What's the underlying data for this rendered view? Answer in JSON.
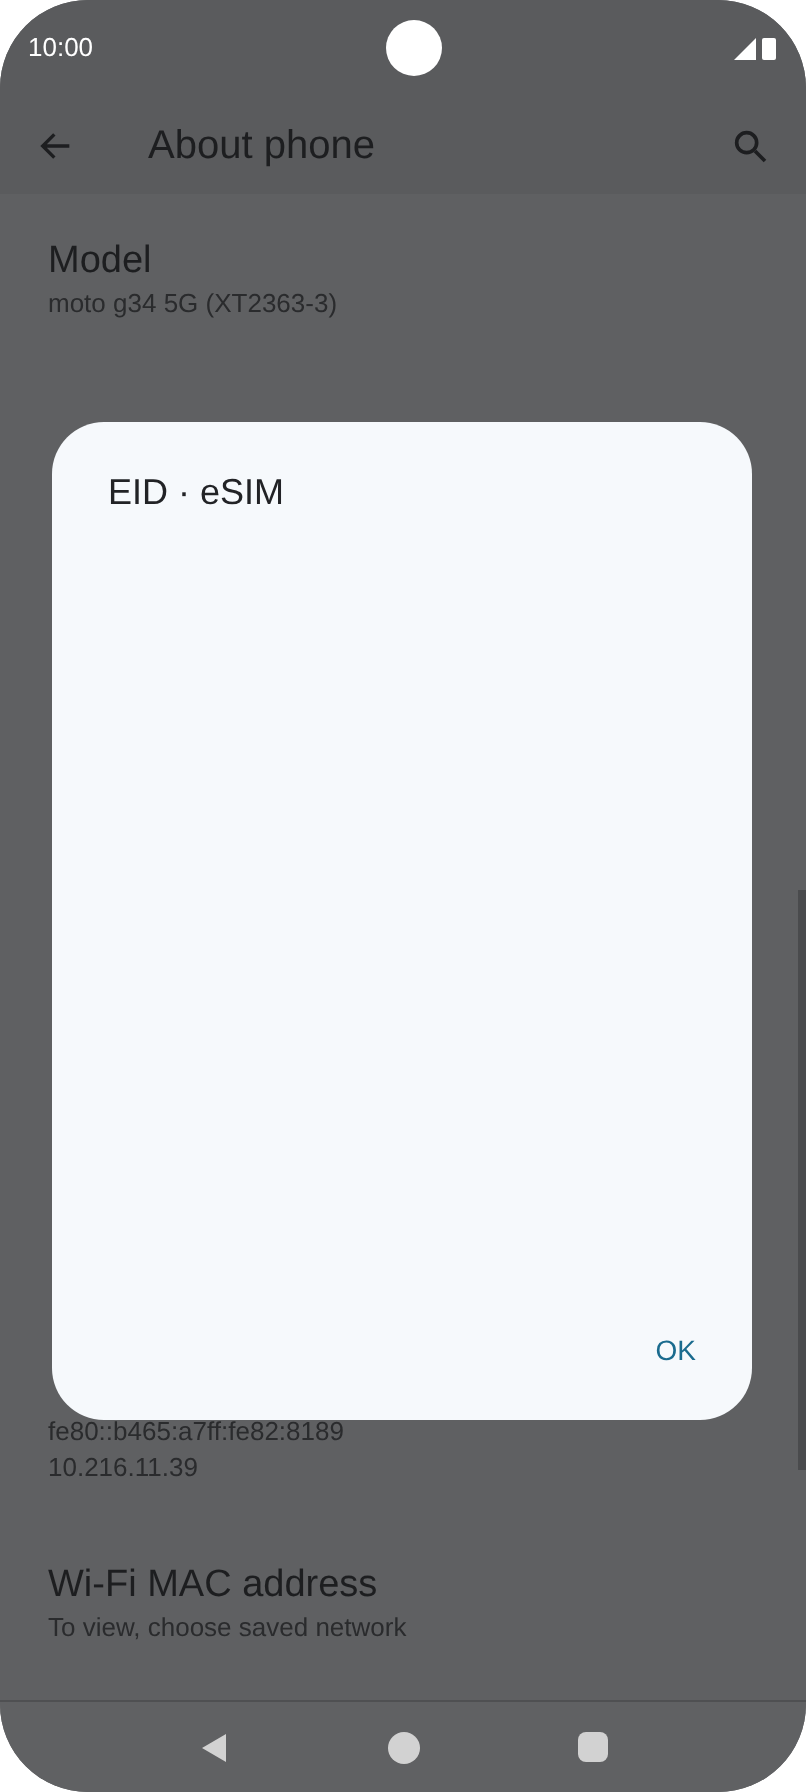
{
  "status_bar": {
    "time": "10:00"
  },
  "app_bar": {
    "title": "About phone"
  },
  "upper_items": [
    {
      "title": "Model",
      "lines": [
        "moto g34 5G (XT2363-3)"
      ]
    }
  ],
  "lower_items": [
    {
      "lines": [
        "fe80::b465:a7ff:fe82:8189",
        "10.216.11.39"
      ]
    },
    {
      "title": "Wi-Fi MAC address",
      "lines": [
        "To view, choose saved network"
      ]
    }
  ],
  "dialog": {
    "title": "EID · eSIM",
    "button": "OK"
  }
}
